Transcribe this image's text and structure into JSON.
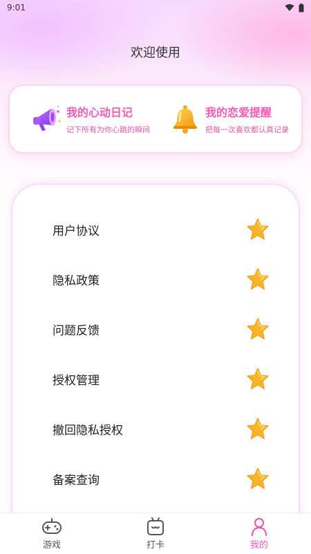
{
  "status_bar": {
    "time": "9:01"
  },
  "header": {
    "title": "欢迎使用"
  },
  "features": [
    {
      "title": "我的心动日记",
      "subtitle": "记下所有为你心跳的瞬间",
      "icon": "megaphone-icon"
    },
    {
      "title": "我的恋爱提醒",
      "subtitle": "把每一次喜欢都认真记录",
      "icon": "bell-icon"
    }
  ],
  "menu": {
    "items": [
      {
        "label": "用户协议",
        "icon": "star-icon"
      },
      {
        "label": "隐私政策",
        "icon": "star-icon"
      },
      {
        "label": "问题反馈",
        "icon": "star-icon"
      },
      {
        "label": "授权管理",
        "icon": "star-icon"
      },
      {
        "label": "撤回隐私授权",
        "icon": "star-icon"
      },
      {
        "label": "备案查询",
        "icon": "star-icon"
      }
    ]
  },
  "tabs": [
    {
      "label": "游戏",
      "icon": "gamepad-icon",
      "active": false
    },
    {
      "label": "打卡",
      "icon": "tv-icon",
      "active": false
    },
    {
      "label": "我的",
      "icon": "user-icon",
      "active": true
    }
  ],
  "colors": {
    "accent": "#f05aaf",
    "feature_title": "#f25cb6",
    "star": "#f7b62a"
  }
}
